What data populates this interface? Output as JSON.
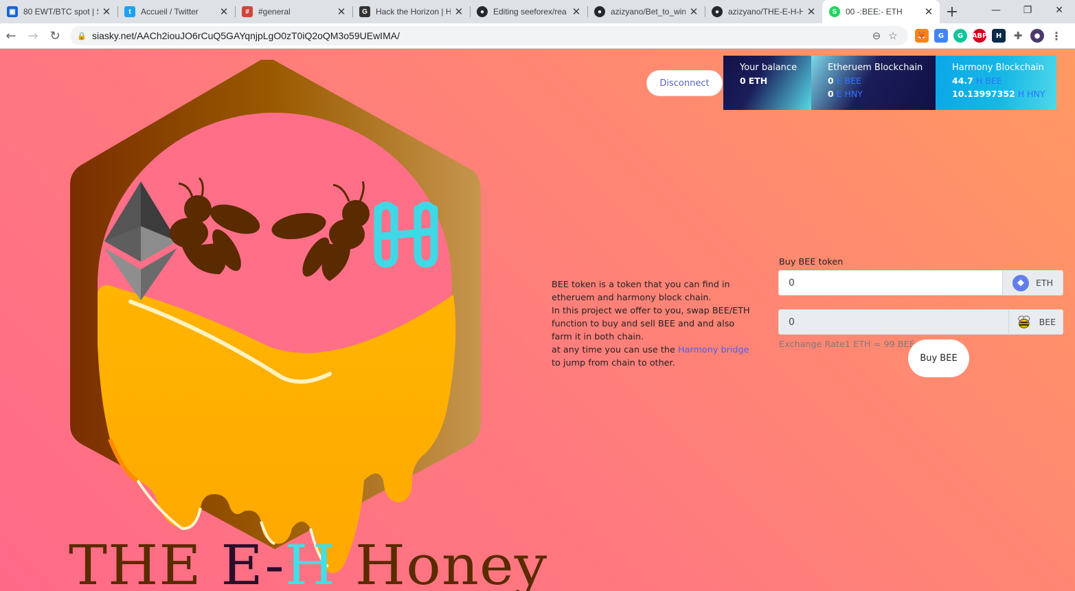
{
  "browser": {
    "tabs": [
      {
        "title": "80 EWT/BTC spot | S",
        "icon": "exchange-icon",
        "color": "#1565d8",
        "active": false
      },
      {
        "title": "Accueil / Twitter",
        "icon": "twitter-icon",
        "color": "#1da1f2",
        "active": false
      },
      {
        "title": "#general",
        "icon": "chat-icon",
        "color": "#d0453a",
        "active": false
      },
      {
        "title": "Hack the Horizon | H",
        "icon": "gitcoin-icon",
        "color": "#333333",
        "active": false
      },
      {
        "title": "Editing seeforex/rea",
        "icon": "github-icon",
        "color": "#24292e",
        "active": false
      },
      {
        "title": "azizyano/Bet_to_win",
        "icon": "github-icon",
        "color": "#24292e",
        "active": false
      },
      {
        "title": "azizyano/THE-E-H-H",
        "icon": "github-icon",
        "color": "#24292e",
        "active": false
      },
      {
        "title": "00 -:BEE:- ETH",
        "icon": "sia-icon",
        "color": "#1ed660",
        "active": true
      }
    ],
    "url": "siasky.net/AACh2iouJO6rCuQ5GAYqnjpLgO0zT0iQ2oQM3o59UEwIMA/",
    "extensions": [
      "metamask-icon",
      "translate-icon",
      "grammarly-icon",
      "adblock-icon",
      "harmony-ext-icon",
      "puzzle-icon",
      "profile-avatar"
    ]
  },
  "logo": {
    "word1": "THE ",
    "word2": "E-",
    "word3": "H",
    "word4": " Honey"
  },
  "wallet": {
    "disconnect_label": "Disconnect",
    "balance": {
      "title": "Your balance",
      "amount": "0",
      "unit": "ETH"
    },
    "ethereum": {
      "title": "Etheruem Blockchain",
      "bee_amount": "0",
      "bee_unit": "E BEE",
      "hny_amount": "0",
      "hny_unit": "E HNY"
    },
    "harmony": {
      "title": "Harmony Blockchain",
      "bee_amount": "44.7",
      "bee_unit": "H BEE",
      "hny_amount": "10.13997352",
      "hny_unit": "H HNY"
    }
  },
  "description": {
    "line1": "BEE token is a token that you can find in",
    "line2": "etheruem and harmony block chain.",
    "line3": "In this project we offer to you, swap BEE/ETH",
    "line4": "function to buy and sell BEE and and also",
    "line5": "farm it in both chain.",
    "line6_pre": "at any time you can use the ",
    "link": "Harmony bridge",
    "line7": "to jump from chain to other."
  },
  "swap": {
    "label": "Buy BEE token",
    "eth_value": "0",
    "eth_unit": "ETH",
    "bee_value": "0",
    "bee_unit": "BEE",
    "rate": "Exchange Rate1 ETH = 99 BEE",
    "buy_label": "Buy BEE"
  },
  "colors": {
    "accent_blue": "#2f73ff",
    "honey": "#ffb000",
    "brown": "#5a2a00",
    "harmony_cyan": "#3fe0e6"
  }
}
